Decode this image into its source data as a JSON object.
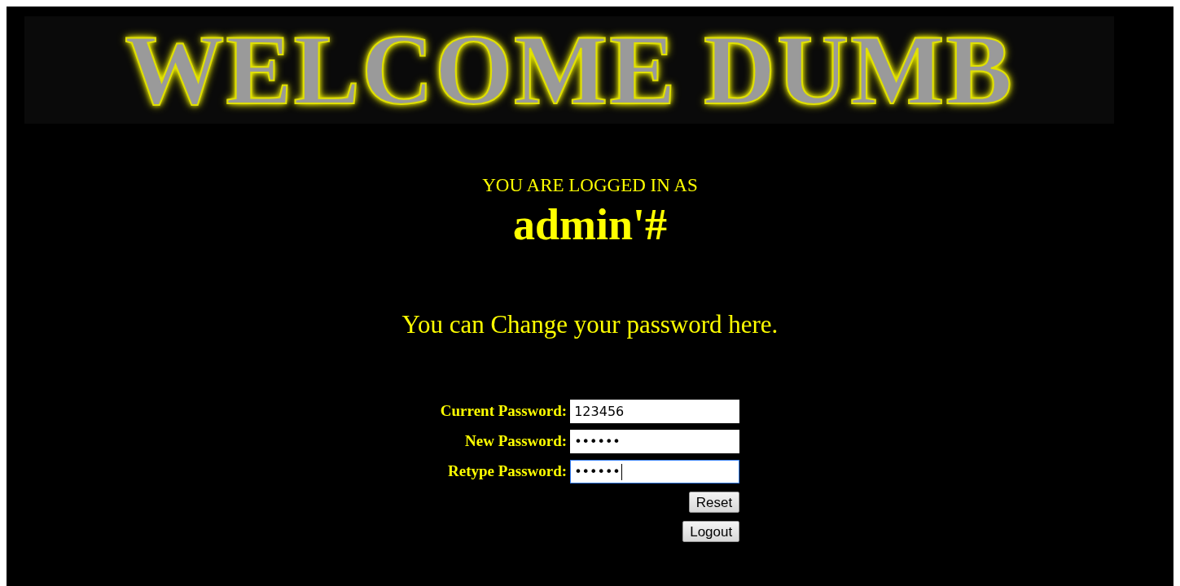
{
  "banner": {
    "title": "WELCOME DUMB"
  },
  "login": {
    "caption": "YOU ARE LOGGED IN AS",
    "username": "admin'#"
  },
  "message": "You can Change your password here.",
  "form": {
    "fields": [
      {
        "label": "Current Password:",
        "value": "123456",
        "focused": false
      },
      {
        "label": "New Password:",
        "value": "••••••",
        "focused": false
      },
      {
        "label": "Retype Password:",
        "value": "••••••",
        "focused": true
      }
    ],
    "buttons": [
      "Reset",
      "Logout"
    ]
  }
}
